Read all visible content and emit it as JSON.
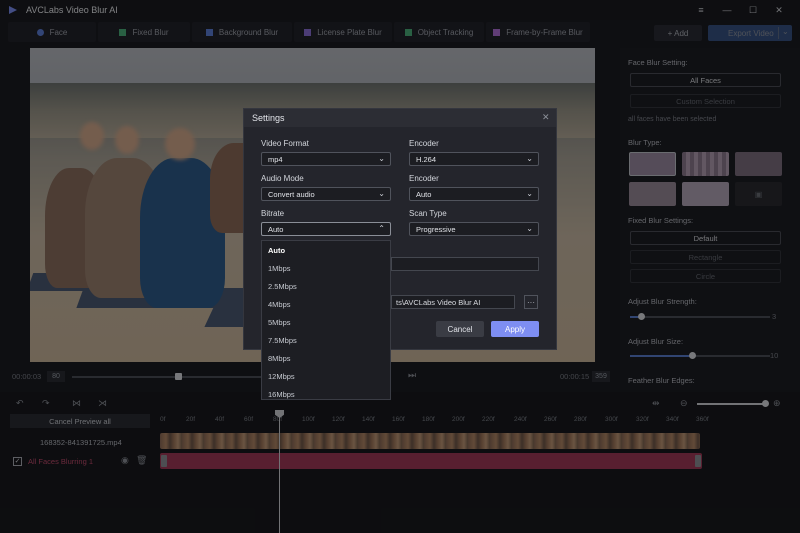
{
  "app": {
    "title": "AVCLabs Video Blur AI"
  },
  "window_controls": {
    "minimize": "—",
    "maximize": "☐",
    "close": "✕",
    "menu": "≡"
  },
  "tabs": [
    {
      "label": "Face",
      "icon": "face-icon",
      "color": "#5b7fd8"
    },
    {
      "label": "Fixed Blur",
      "icon": "plus-icon",
      "color": "#4caf7a"
    },
    {
      "label": "Background Blur",
      "icon": "background-icon",
      "color": "#5b7fd8"
    },
    {
      "label": "License Plate Blur",
      "icon": "car-icon",
      "color": "#8a6fd8"
    },
    {
      "label": "Object Tracking",
      "icon": "tracking-icon",
      "color": "#4caf7a"
    },
    {
      "label": "Frame-by-Frame Blur",
      "icon": "frame-icon",
      "color": "#b06fd8"
    }
  ],
  "toolbar": {
    "add_label": "+ Add",
    "export_label": "Export Video"
  },
  "preview": {
    "time_start": "00:00:03",
    "frame_start": "80",
    "time_end": "00:00:15",
    "frame_end": "359"
  },
  "right_panel": {
    "face_blur_setting": "Face Blur Setting:",
    "all_faces": "All Faces",
    "custom_selection": "Custom Selection",
    "selected_note": "all faces have been selected",
    "blur_type": "Blur Type:",
    "fixed_blur_settings": "Fixed Blur Settings:",
    "default": "Default",
    "rectangle": "Rectangle",
    "circle": "Circle",
    "adjust_strength": "Adjust Blur Strength:",
    "strength_value": "3",
    "adjust_size": "Adjust Blur Size:",
    "size_value": "10",
    "feather_edges": "Feather Blur Edges:"
  },
  "timeline": {
    "cancel_preview": "Cancel Preview all",
    "file_name": "168352-841391725.mp4",
    "track_label": "All Faces Blurring 1",
    "ruler": [
      "0f",
      "20f",
      "40f",
      "60f",
      "80f",
      "100f",
      "120f",
      "140f",
      "160f",
      "180f",
      "200f",
      "220f",
      "240f",
      "260f",
      "280f",
      "300f",
      "320f",
      "340f",
      "360f"
    ]
  },
  "dialog": {
    "title": "Settings",
    "video_format_label": "Video Format",
    "video_format_value": "mp4",
    "encoder_label": "Encoder",
    "encoder_value": "H.264",
    "audio_mode_label": "Audio Mode",
    "audio_mode_value": "Convert audio",
    "audio_encoder_label": "Encoder",
    "audio_encoder_value": "Auto",
    "bitrate_label": "Bitrate",
    "bitrate_value": "Auto",
    "scan_type_label": "Scan Type",
    "scan_type_value": "Progressive",
    "output_path": "ts\\AVCLabs Video Blur AI",
    "browse": "···",
    "cancel": "Cancel",
    "apply": "Apply"
  },
  "bitrate_options": [
    "Auto",
    "1Mbps",
    "2.5Mbps",
    "4Mbps",
    "5Mbps",
    "7.5Mbps",
    "8Mbps",
    "12Mbps",
    "16Mbps"
  ]
}
